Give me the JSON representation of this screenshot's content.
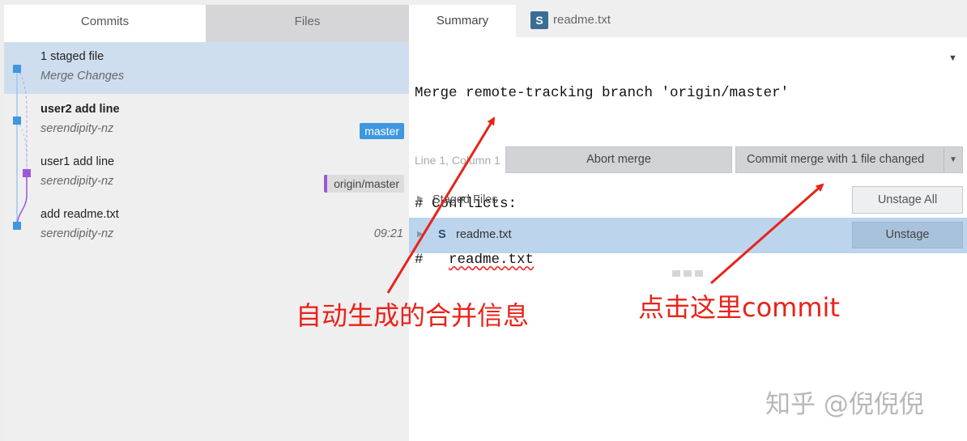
{
  "left_tabs": {
    "commits": "Commits",
    "files": "Files"
  },
  "commits": [
    {
      "title": "1 staged file",
      "subtitle": "Merge Changes",
      "selected": true
    },
    {
      "title": "user2 add line",
      "subtitle": "serendipity-nz",
      "badge": "master"
    },
    {
      "title": "user1 add line",
      "subtitle": "serendipity-nz",
      "badge": "origin/master"
    },
    {
      "title": "add readme.txt",
      "subtitle": "serendipity-nz",
      "time": "09:21"
    }
  ],
  "right_tabs": {
    "summary": "Summary",
    "file_icon": "S",
    "file": "readme.txt"
  },
  "commit_message": {
    "line1": "Merge remote-tracking branch 'origin/master'",
    "line2": "# Conflicts:",
    "line3_prefix": "#   ",
    "line3_file": "readme.txt"
  },
  "toolbar": {
    "line_col": "Line 1, Column 1",
    "abort": "Abort merge",
    "commit": "Commit merge with 1 file changed"
  },
  "staged": {
    "label": "Staged Files",
    "unstage_all": "Unstage All",
    "file_status": "S",
    "file_name": "readme.txt",
    "unstage": "Unstage"
  },
  "annotations": {
    "left": "自动生成的合并信息",
    "right": "点击这里commit",
    "watermark": "知乎 @倪倪倪"
  },
  "colors": {
    "accent": "#3f97e0",
    "selection": "#cfdeef",
    "file_selection": "#bcd4ec",
    "annotation": "#e8231a",
    "origin_branch": "#9b59d6"
  }
}
